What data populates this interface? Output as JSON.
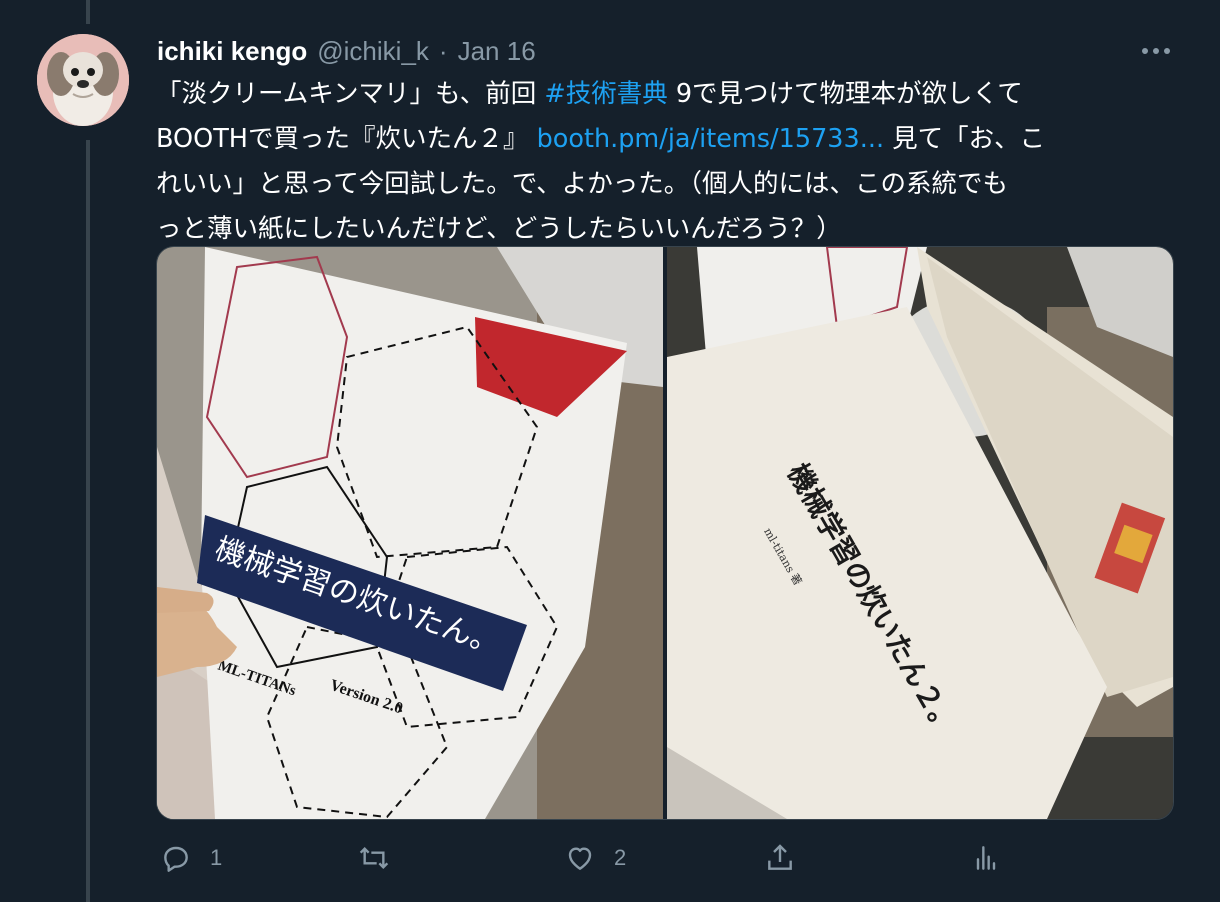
{
  "tweet": {
    "author_name": "ichiki kengo",
    "author_handle": "@ichiki_k",
    "separator": "·",
    "date": "Jan 16",
    "text": {
      "l1_a": "「淡クリームキンマリ」も、前回",
      "l1_hashtag": "#技術書典",
      "l1_b": "9で見つけて物理本が欲しくて",
      "l2_a": "BOOTHで買った『炊いたん２』",
      "l2_link": "booth.pm/ja/items/15733...",
      "l2_b": "見て「お、こ",
      "l3": "れいい」と思って今回試した。で、よかった。（個人的には、この系統でも",
      "l4": "っと薄い紙にしたいんだけど、どうしたらいいんだろう？）"
    },
    "media": {
      "left_photo": {
        "title": "機械学習の炊いたん。",
        "author": "ML-TITANs",
        "version": "Version 2.0"
      },
      "right_photo": {
        "title": "機械学習の炊いたん２。",
        "author": "ml-titans 著"
      }
    },
    "actions": {
      "reply_count": "1",
      "retweet_count": "",
      "like_count": "2"
    }
  },
  "icons": {
    "reply": "reply-icon",
    "retweet": "retweet-icon",
    "like": "heart-icon",
    "share": "share-icon",
    "analytics": "analytics-icon",
    "more": "more-icon"
  },
  "colors": {
    "background": "#15202b",
    "text": "#ffffff",
    "secondary": "#8899a6",
    "link": "#1da1f2",
    "border": "#38444d"
  }
}
